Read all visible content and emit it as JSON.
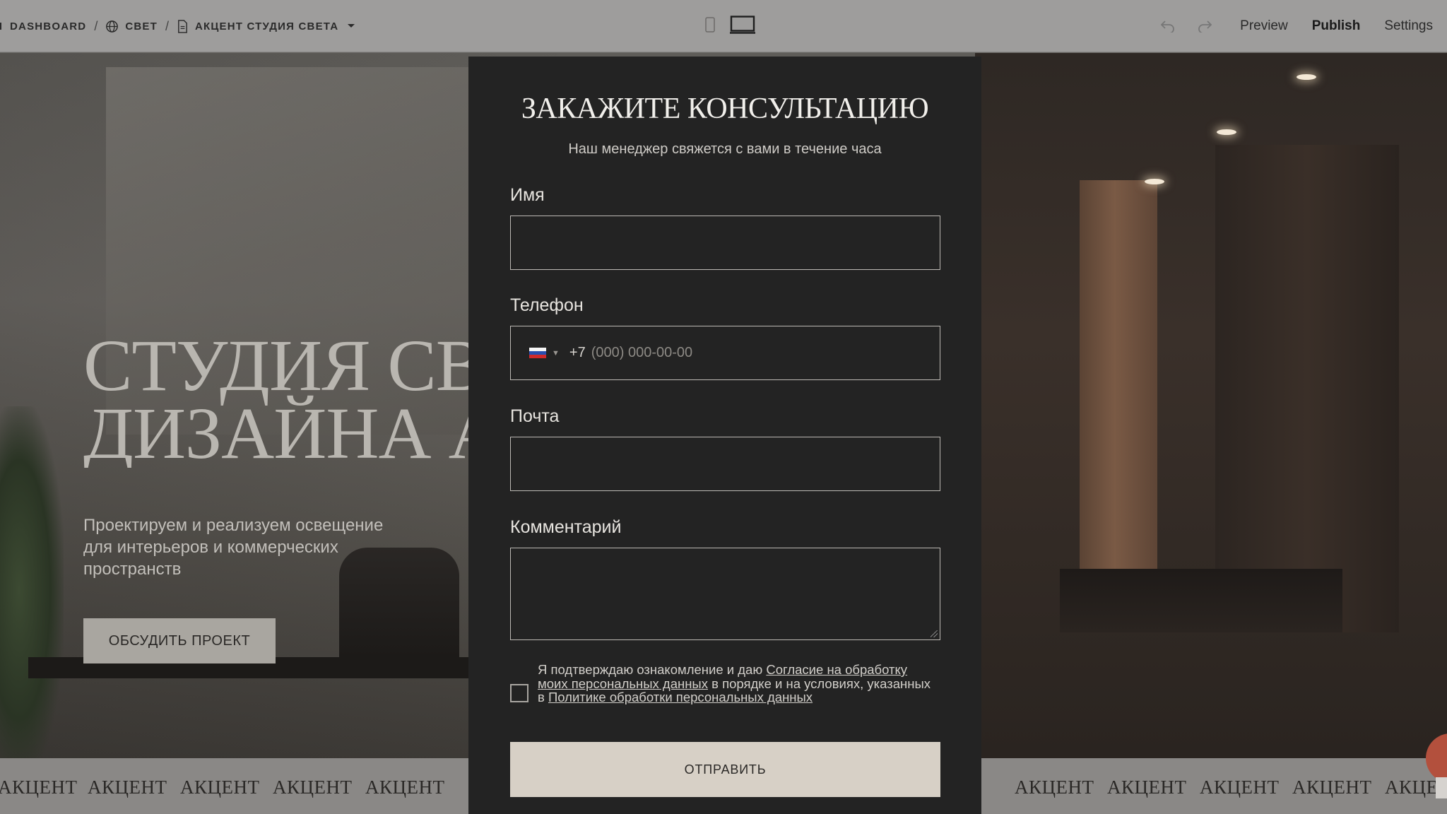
{
  "editor": {
    "breadcrumbs": [
      {
        "label": "DASHBOARD",
        "icon": "arrow-left-icon"
      },
      {
        "label": "СВЕТ",
        "icon": "globe-icon"
      },
      {
        "label": "АКЦЕНТ СТУДИЯ СВЕТА",
        "icon": "page-icon"
      }
    ],
    "actions": {
      "preview": "Preview",
      "publish": "Publish",
      "settings": "Settings"
    },
    "active_device": "desktop"
  },
  "hero": {
    "title_line1": "СТУДИЯ СВЕТОВОГО",
    "title_line2": "ДИЗАЙНА АКЦЕНТ",
    "subtitle": "Проектируем и реализуем освещение для интерьеров и коммерческих пространств",
    "cta": "ОБСУДИТЬ ПРОЕКТ"
  },
  "marquee": {
    "word": "АКЦЕНТ"
  },
  "modal": {
    "title": "ЗАКАЖИТЕ КОНСУЛЬТАЦИЮ",
    "subtitle": "Наш менеджер свяжется с вами в течение часа",
    "fields": {
      "name_label": "Имя",
      "name_value": "",
      "phone_label": "Телефон",
      "phone_country": "RU",
      "phone_code": "+7",
      "phone_placeholder": "(000) 000-00-00",
      "email_label": "Почта",
      "email_value": "",
      "comment_label": "Комментарий",
      "comment_value": ""
    },
    "consent": {
      "checked": false,
      "text_1": "Я подтверждаю ознакомление и даю ",
      "link_1": "Согласие на обработку моих персональных данных",
      "text_2": " в порядке и на условиях, указанных в ",
      "link_2": "Политике обработки персональных данных"
    },
    "submit": "ОТПРАВИТЬ"
  },
  "colors": {
    "modal_bg": "#232323",
    "submit_bg": "#d7d0c6",
    "topbar_bg": "#9e9d9c"
  }
}
